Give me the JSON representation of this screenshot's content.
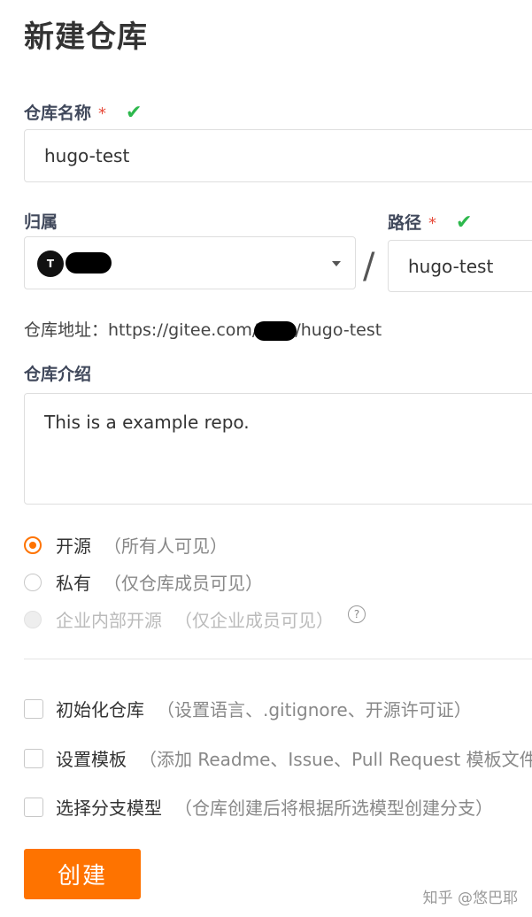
{
  "page_title": "新建仓库",
  "repo_name": {
    "label": "仓库名称",
    "required_mark": "*",
    "valid_mark": "✔",
    "value": "hugo-test"
  },
  "owner": {
    "label": "归属",
    "avatar_letter": "T"
  },
  "path": {
    "label": "路径",
    "required_mark": "*",
    "valid_mark": "✔",
    "separator": "/",
    "value": "hugo-test"
  },
  "repo_url": {
    "label": "仓库地址：",
    "prefix": "https://gitee.com/",
    "suffix": "/hugo-test"
  },
  "description": {
    "label": "仓库介绍",
    "value": "This is a example repo."
  },
  "visibility": {
    "options": [
      {
        "label": "开源",
        "hint": "（所有人可见）",
        "state": "checked"
      },
      {
        "label": "私有",
        "hint": "（仅仓库成员可见）",
        "state": "unchecked"
      },
      {
        "label": "企业内部开源",
        "hint": "（仅企业成员可见）",
        "state": "disabled",
        "help_icon": "?"
      }
    ]
  },
  "options": [
    {
      "label": "初始化仓库",
      "hint": "（设置语言、.gitignore、开源许可证）"
    },
    {
      "label": "设置模板",
      "hint": "（添加 Readme、Issue、Pull Request 模板文件）"
    },
    {
      "label": "选择分支模型",
      "hint": "（仓库创建后将根据所选模型创建分支）"
    }
  ],
  "create_button": "创建",
  "watermark": "知乎 @悠巴耶",
  "colors": {
    "accent": "#fe7300",
    "valid": "#2db84d",
    "required": "#e74c3c"
  }
}
